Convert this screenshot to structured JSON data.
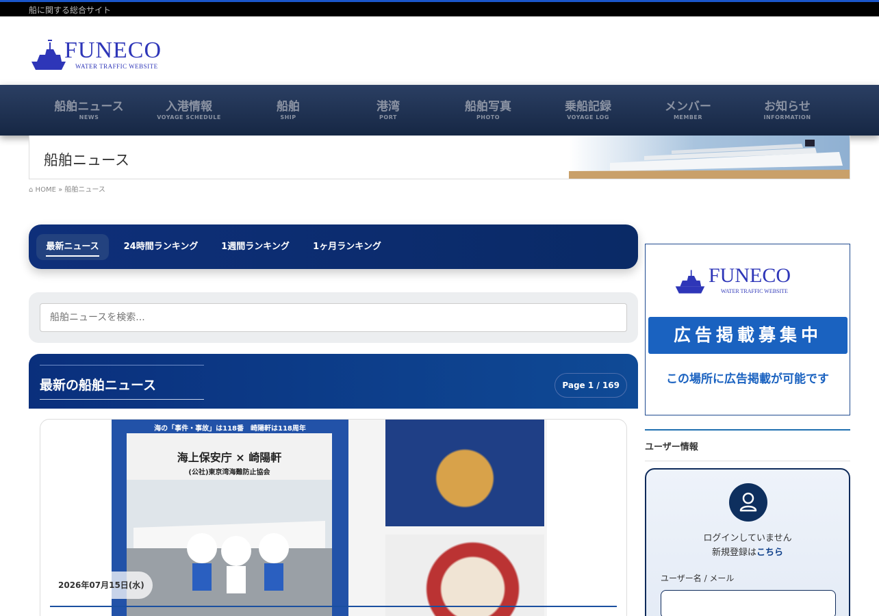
{
  "topbar": {
    "tagline": "船に関する総合サイト"
  },
  "logo": {
    "name": "FUNECO",
    "subtitle": "WATER TRAFFIC WEBSITE"
  },
  "nav": [
    {
      "jp": "船舶ニュース",
      "en": "NEWS"
    },
    {
      "jp": "入港情報",
      "en": "VOYAGE SCHEDULE"
    },
    {
      "jp": "船舶",
      "en": "SHIP"
    },
    {
      "jp": "港湾",
      "en": "PORT"
    },
    {
      "jp": "船舶写真",
      "en": "PHOTO"
    },
    {
      "jp": "乗船記録",
      "en": "VOYAGE LOG"
    },
    {
      "jp": "メンバー",
      "en": "MEMBER"
    },
    {
      "jp": "お知らせ",
      "en": "INFORMATION"
    }
  ],
  "page": {
    "title": "船舶ニュース"
  },
  "breadcrumb": {
    "home": "HOME",
    "sep": "»",
    "current": "船舶ニュース"
  },
  "tabs": [
    {
      "label": "最新ニュース",
      "active": true
    },
    {
      "label": "24時間ランキング",
      "active": false
    },
    {
      "label": "1週間ランキング",
      "active": false
    },
    {
      "label": "1ヶ月ランキング",
      "active": false
    }
  ],
  "search": {
    "placeholder": "船舶ニュースを検索..."
  },
  "news": {
    "heading": "最新の船舶ニュース",
    "page_indicator": "Page 1 / 169",
    "card": {
      "date": "2026年07月15日(水)",
      "poster_top": "海の「事件・事故」は118番　崎陽軒は118周年",
      "poster_title": "海上保安庁 × 崎陽軒",
      "poster_sub": "(公社)東京湾海難防止協会"
    }
  },
  "sidebar": {
    "ad": {
      "logo_name": "FUNECO",
      "logo_subtitle": "WATER TRAFFIC WEBSITE",
      "banner": "広告掲載募集中",
      "note": "この場所に広告掲載が可能です"
    },
    "user_section": {
      "title": "ユーザー情報",
      "status": "ログインしていません",
      "register_prefix": "新規登録は",
      "register_link": "こちら",
      "username_label": "ユーザー名 / メール"
    }
  },
  "colors": {
    "brand": "#2e36b8",
    "nav_bg": "#1d3153",
    "accent": "#1a62c0",
    "dark_blue": "#0a2a66"
  }
}
